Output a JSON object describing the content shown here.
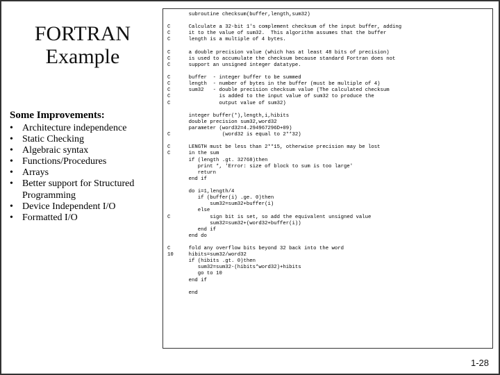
{
  "title_line1": "FORTRAN",
  "title_line2": "Example",
  "improvements_heading": "Some Improvements:",
  "improvements": [
    "Architecture independence",
    "Static Checking",
    "Algebraic syntax",
    "Functions/Procedures",
    "Arrays",
    "Better support for Structured Programming",
    "Device Independent I/O",
    "Formatted I/O"
  ],
  "code": "       subroutine checksum(buffer,length,sum32)\n\nC      Calculate a 32-bit 1's complement checksum of the input buffer, adding\nC      it to the value of sum32.  This algorithm assumes that the buffer\nC      length is a multiple of 4 bytes.\n\nC      a double precision value (which has at least 48 bits of precision)\nC      is used to accumulate the checksum because standard Fortran does not\nC      support an unsigned integer datatype.\n\nC      buffer  - integer buffer to be summed\nC      length  - number of bytes in the buffer (must be multiple of 4)\nC      sum32   - double precision checksum value (The calculated checksum\nC                is added to the input value of sum32 to produce the\nC                output value of sum32)\n\n       integer buffer(*),length,i,hibits\n       double precision sum32,word32\n       parameter (word32=4.294967296D+09)\nC                 (word32 is equal to 2**32)\n\nC      LENGTH must be less than 2**15, otherwise precision may be lost\nC      in the sum\n       if (length .gt. 32768)then\n          print *, 'Error: size of block to sum is too large'\n          return\n       end if\n\n       do i=1,length/4\n          if (buffer(i) .ge. 0)then\n              sum32=sum32+buffer(i)\n          else\nC             sign bit is set, so add the equivalent unsigned value\n              sum32=sum32+(word32+buffer(i))\n          end if\n       end do\n\nC      fold any overflow bits beyond 32 back into the word\n10     hibits=sum32/word32\n       if (hibits .gt. 0)then\n          sum32=sum32-(hibits*word32)+hibits\n          go to 10\n       end if\n\n       end",
  "page_number": "1-28"
}
